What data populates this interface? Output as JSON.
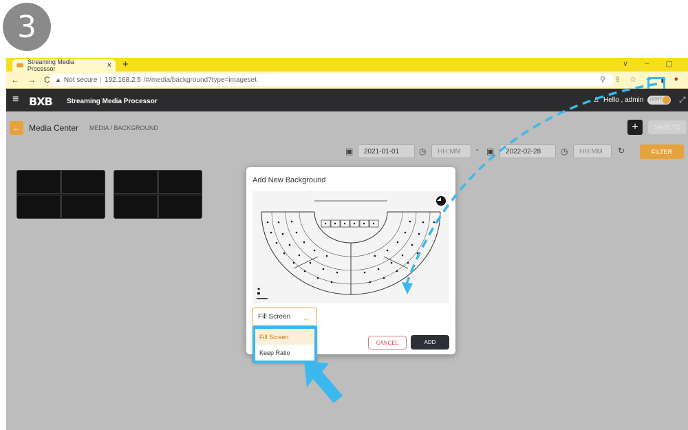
{
  "step": {
    "number": "3"
  },
  "browser": {
    "tab_title": "Streaming Media Processor",
    "tab_close": "×",
    "new_tab": "+",
    "window_controls": [
      "∨",
      "–",
      "▢"
    ],
    "nav": [
      "←",
      "→",
      "C"
    ],
    "security": "Not secure",
    "url_host": "192.168.2.5",
    "url_path": "/#/media/background?type=imageset"
  },
  "app": {
    "logo": "BXB",
    "title": "Streaming Media Processor",
    "greeting": "Hello , admin",
    "theme_toggle": "LIGHT"
  },
  "page": {
    "title": "Media Center",
    "breadcrumb": "MEDIA / BACKGROUND",
    "save_to": "SAVE TO",
    "filter": {
      "start_date": "2021-01-01",
      "start_time_placeholder": "HH:MM",
      "separator": "-",
      "end_date": "2022-02-28",
      "end_time_placeholder": "HH:MM",
      "button": "FILTER"
    }
  },
  "modal": {
    "title": "Add New Background",
    "fit_mode": "Fill Screen",
    "options": [
      "Fill Screen",
      "Keep Ratio"
    ],
    "cancel": "CANCEL",
    "add": "ADD"
  },
  "colors": {
    "accent": "#e6a23c",
    "tab_bar": "#f7df1e",
    "header": "#2c2c2e",
    "annotation": "#3cb8ee"
  }
}
